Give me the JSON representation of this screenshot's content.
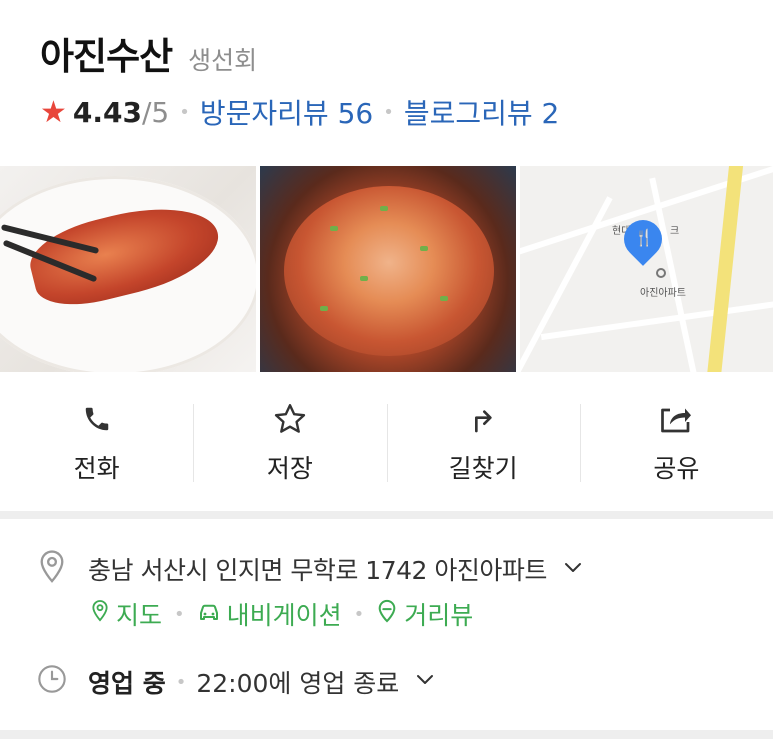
{
  "place": {
    "name": "아진수산",
    "category": "생선회",
    "rating": "4.43",
    "rating_max": "/5",
    "visitor_review": "방문자리뷰 56",
    "blog_review": "블로그리뷰 2"
  },
  "map": {
    "label_top": "현대",
    "label_bottom": "아진아파트",
    "label_right": "크"
  },
  "actions": [
    {
      "label": "전화",
      "icon": "phone-icon"
    },
    {
      "label": "저장",
      "icon": "star-outline-icon"
    },
    {
      "label": "길찾기",
      "icon": "directions-icon"
    },
    {
      "label": "공유",
      "icon": "share-icon"
    }
  ],
  "info": {
    "address": "충남 서산시 인지면 무학로 1742 아진아파트",
    "links": [
      {
        "label": "지도",
        "icon": "map-pin-icon"
      },
      {
        "label": "내비게이션",
        "icon": "car-icon"
      },
      {
        "label": "거리뷰",
        "icon": "streetview-icon"
      }
    ],
    "hours_status": "영업 중",
    "hours_text": "22:00에 영업 종료"
  },
  "colors": {
    "accent_blue": "#2a66b8",
    "star_red": "#e8463b",
    "link_green": "#3dab52",
    "pin_blue": "#3a86ef"
  }
}
